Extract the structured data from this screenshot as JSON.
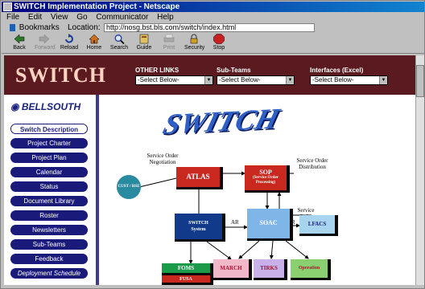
{
  "window": {
    "title": "SWITCH Implementation Project - Netscape"
  },
  "menu": [
    "File",
    "Edit",
    "View",
    "Go",
    "Communicator",
    "Help"
  ],
  "location_bar": {
    "bookmarks": "Bookmarks",
    "label": "Location:",
    "url": "http://nosg.bst.bls.com/switch/index.html"
  },
  "toolbar": [
    {
      "label": "Back",
      "icon": "back-arrow-icon",
      "enabled": true
    },
    {
      "label": "Forward",
      "icon": "forward-arrow-icon",
      "enabled": false
    },
    {
      "label": "Reload",
      "icon": "reload-icon",
      "enabled": true
    },
    {
      "label": "Home",
      "icon": "home-icon",
      "enabled": true
    },
    {
      "label": "Search",
      "icon": "search-icon",
      "enabled": true
    },
    {
      "label": "Guide",
      "icon": "guide-icon",
      "enabled": true
    },
    {
      "label": "Print",
      "icon": "print-icon",
      "enabled": false
    },
    {
      "label": "Security",
      "icon": "lock-icon",
      "enabled": true
    },
    {
      "label": "Stop",
      "icon": "stop-icon",
      "enabled": true
    }
  ],
  "banner": {
    "logo": "SWITCH",
    "dropdowns": [
      {
        "label": "OTHER LINKS",
        "value": "-Select Below-"
      },
      {
        "label": "Sub-Teams",
        "value": "-Select Below-"
      },
      {
        "label": "Interfaces (Excel)",
        "value": "-Select Below-"
      }
    ]
  },
  "sidebar": {
    "brand": "BELLSOUTH",
    "items": [
      {
        "label": "Switch Description",
        "active": true
      },
      {
        "label": "Project Charter",
        "active": false
      },
      {
        "label": "Project Plan",
        "active": false
      },
      {
        "label": "Calendar",
        "active": false
      },
      {
        "label": "Status",
        "active": false
      },
      {
        "label": "Document Library",
        "active": false
      },
      {
        "label": "Roster",
        "active": false
      },
      {
        "label": "Newsletters",
        "active": false
      },
      {
        "label": "Sub-Teams",
        "active": false
      },
      {
        "label": "Feedback",
        "active": false
      },
      {
        "label": "Deployment Schedule",
        "active": false
      }
    ]
  },
  "main": {
    "heading": "SWITCH",
    "diagram": {
      "nodes": {
        "cust": "CUST / RSE",
        "atlas": "ATLAS",
        "sop": "SOP",
        "sop_sub": "(Service Order Processing)",
        "switch": "SWITCH",
        "switch_sub": "System",
        "soac": "SOAC",
        "lfacs": "LFACS",
        "foms": "FOMS",
        "fusa": "FUSA",
        "march": "MARCH",
        "tirks": "TIRKS",
        "operation": "Operation"
      },
      "labels": {
        "service_order_negotiation": "Service Order Negotiation",
        "service_order_distribution": "Service Order Distribution",
        "service_order": "Service Order",
        "ar": "AR"
      },
      "colors": {
        "atlas": "#c8281e",
        "sop": "#c8281e",
        "switch": "#123a8a",
        "soac": "#7fb6e8",
        "lfacs": "#a8d4f0",
        "foms": "#1b9a4a",
        "fusa": "#c8281e",
        "march": "#f0b8c8",
        "tirks": "#c8b0e8",
        "operation": "#8ad070",
        "cust": "#2a8aa0"
      }
    }
  }
}
